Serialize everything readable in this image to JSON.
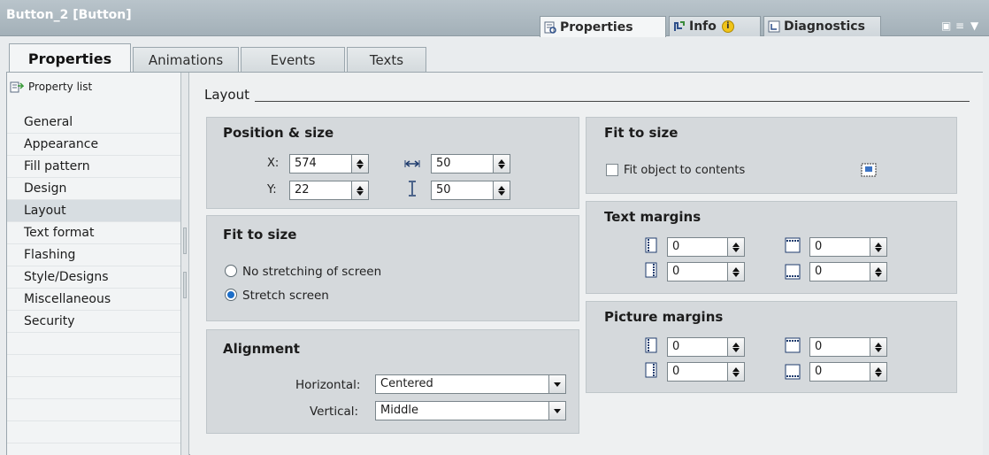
{
  "window": {
    "title": "Button_2 [Button]"
  },
  "inspector_tabs": [
    {
      "label": "Properties",
      "icon": "properties-icon",
      "active": true
    },
    {
      "label": "Info",
      "icon": "info-icon",
      "badge_icon": "info-badge-icon"
    },
    {
      "label": "Diagnostics",
      "icon": "diagnostics-icon"
    }
  ],
  "sub_tabs": [
    "Properties",
    "Animations",
    "Events",
    "Texts"
  ],
  "nav": {
    "header": "Property list",
    "items": [
      "General",
      "Appearance",
      "Fill pattern",
      "Design",
      "Layout",
      "Text format",
      "Flashing",
      "Style/Designs",
      "Miscellaneous",
      "Security"
    ],
    "selected": "Layout"
  },
  "main": {
    "section_title": "Layout",
    "position_size": {
      "title": "Position & size",
      "x_label": "X:",
      "x_value": "574",
      "y_label": "Y:",
      "y_value": "22",
      "width_value": "50",
      "height_value": "50"
    },
    "fit_screen": {
      "title": "Fit to size",
      "option_no_stretch": "No stretching of screen",
      "option_stretch": "Stretch screen",
      "selected": "Stretch screen"
    },
    "alignment": {
      "title": "Alignment",
      "horizontal_label": "Horizontal:",
      "horizontal_value": "Centered",
      "vertical_label": "Vertical:",
      "vertical_value": "Middle"
    },
    "fit_object": {
      "title": "Fit to size",
      "checkbox_label": "Fit object to contents",
      "checked": false
    },
    "text_margins": {
      "title": "Text margins",
      "left": "0",
      "top": "0",
      "right": "0",
      "bottom": "0"
    },
    "picture_margins": {
      "title": "Picture margins",
      "left": "0",
      "top": "0",
      "right": "0",
      "bottom": "0"
    }
  },
  "colors": {
    "accent": "#1d6ec8",
    "titlebar": "#a3b0b8",
    "group_bg": "#d5d9dc"
  }
}
